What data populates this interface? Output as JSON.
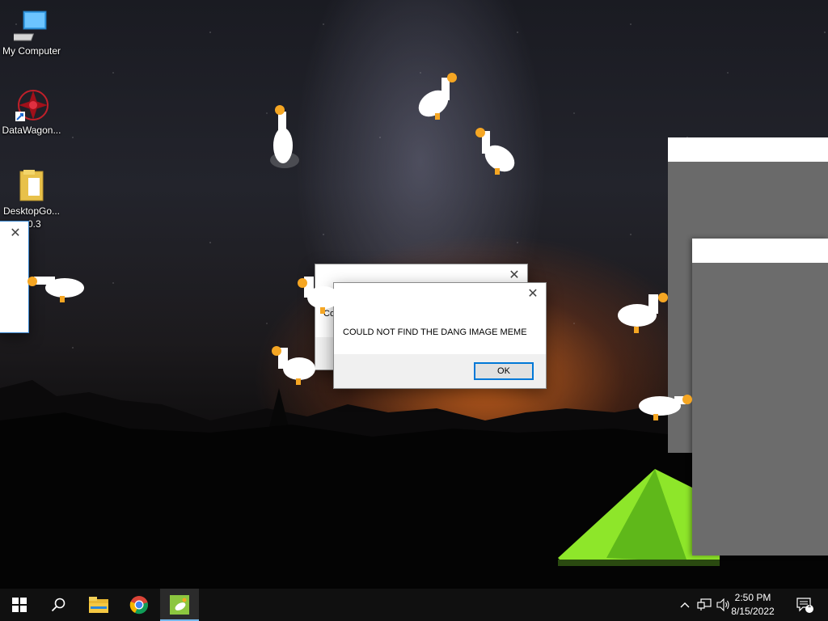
{
  "desktop": {
    "icons": [
      {
        "label": "My Computer",
        "icon": "computer-icon"
      },
      {
        "label": "DataWagon...",
        "icon": "datawagon-icon"
      },
      {
        "label": "DesktopGo...",
        "icon": "folder-icon"
      }
    ],
    "partial_label": "0.3"
  },
  "dialogs": {
    "front": {
      "message": "COULD NOT FIND THE DANG IMAGE MEME",
      "ok_label": "OK",
      "close_glyph": "✕"
    },
    "back": {
      "close_glyph": "✕",
      "partial_text": "Co"
    },
    "left": {
      "close_glyph": "✕"
    }
  },
  "taskbar": {
    "time": "2:50 PM",
    "date": "8/15/2022",
    "notification_count": "1",
    "apps": [
      "start-icon",
      "search-icon",
      "file-explorer-icon",
      "chrome-icon",
      "desktop-goose-icon"
    ]
  },
  "colors": {
    "accent": "#0078d7",
    "taskbar": "#101010",
    "goose_beak": "#f5a623"
  }
}
